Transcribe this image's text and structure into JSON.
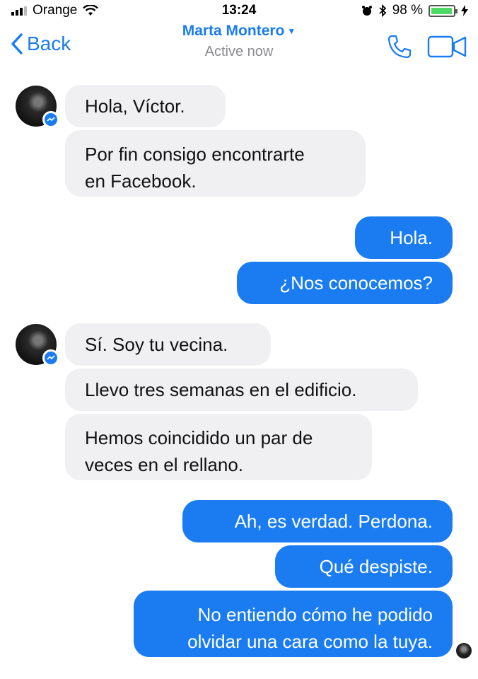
{
  "status_bar": {
    "carrier": "Orange",
    "time": "13:24",
    "battery": "98 %",
    "battery_level": 0.98
  },
  "nav": {
    "back_label": "Back",
    "contact_name": "Marta Montero",
    "status": "Active now"
  },
  "messages": [
    {
      "from": "contact",
      "lines": [
        "Hola, Víctor."
      ]
    },
    {
      "from": "contact",
      "lines": [
        "Por fin consigo encontrarte",
        "en Facebook."
      ]
    },
    {
      "from": "me",
      "lines": [
        "Hola."
      ]
    },
    {
      "from": "me",
      "lines": [
        "¿Nos conocemos?"
      ]
    },
    {
      "from": "contact",
      "lines": [
        "Sí. Soy tu vecina."
      ]
    },
    {
      "from": "contact",
      "lines": [
        "Llevo tres semanas en el edificio."
      ]
    },
    {
      "from": "contact",
      "lines": [
        "Hemos coincidido un par de",
        "veces en el rellano."
      ]
    },
    {
      "from": "me",
      "lines": [
        "Ah, es verdad. Perdona."
      ]
    },
    {
      "from": "me",
      "lines": [
        "Qué despiste."
      ]
    },
    {
      "from": "me",
      "lines": [
        "No entiendo cómo he podido",
        "olvidar una cara como la tuya."
      ]
    }
  ],
  "colors": {
    "accent": "#1a7cf0",
    "received_bubble": "#f0f0f2",
    "sent_text": "#ffffff"
  }
}
